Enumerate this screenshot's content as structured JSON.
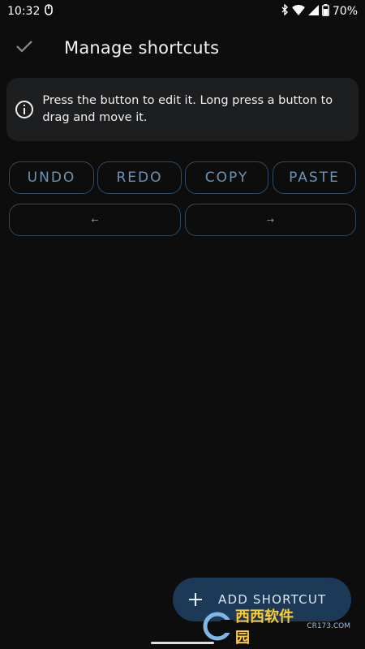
{
  "status_bar": {
    "time": "10:32",
    "battery_percent": "70%",
    "icons": [
      "mouse-icon",
      "bluetooth-icon",
      "wifi-icon",
      "signal-icon",
      "battery-icon"
    ]
  },
  "app_bar": {
    "title": "Manage shortcuts",
    "confirm_icon": "check-icon"
  },
  "info_card": {
    "icon": "info-icon",
    "text": "Press the button to edit it. Long press a button to drag and move it."
  },
  "shortcuts": {
    "row1": [
      "UNDO",
      "REDO",
      "COPY",
      "PASTE"
    ],
    "row2": [
      "←",
      "→"
    ]
  },
  "fab": {
    "icon": "plus-icon",
    "label": "ADD SHORTCUT"
  },
  "watermark": {
    "text": "西西软件园",
    "sub": "CR173.COM"
  },
  "colors": {
    "background": "#0d0d0e",
    "card": "#1d1e20",
    "accent": "#6f93b2",
    "fab": "#1c3a57"
  }
}
